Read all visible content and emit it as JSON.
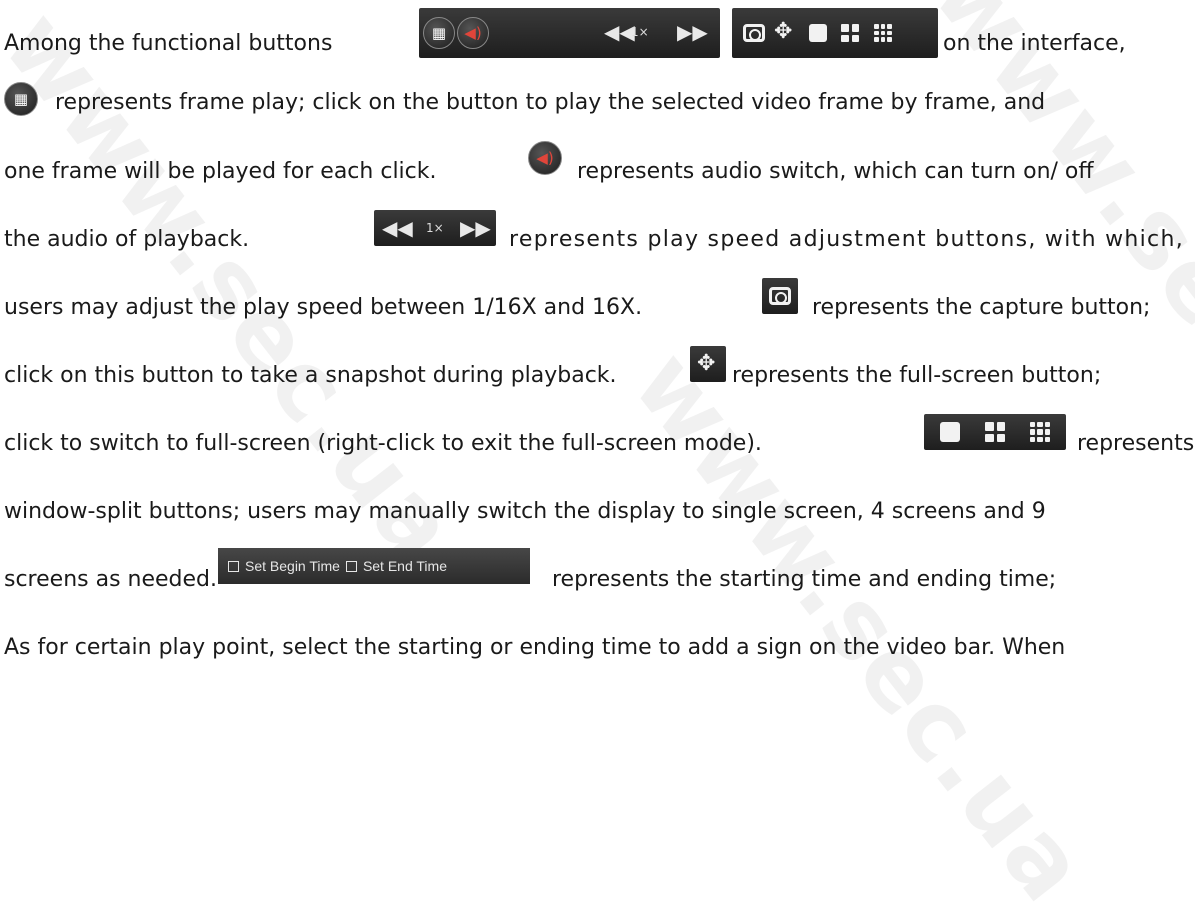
{
  "watermark": "www.sec.ua",
  "lines": [
    {
      "id": "l1",
      "segments": [
        "Among the functional buttons",
        "on the interface,"
      ]
    },
    {
      "id": "l2",
      "segments": [
        "represents frame play; click on the button to play the selected video frame by frame, and"
      ]
    },
    {
      "id": "l3",
      "segments": [
        "one frame will be played for each click.",
        "represents audio switch, which can turn on/ off"
      ]
    },
    {
      "id": "l4",
      "segments": [
        "the audio of playback.",
        "represents play speed adjustment buttons, with which,"
      ]
    },
    {
      "id": "l5",
      "segments": [
        "users may adjust the play speed between 1/16X and 16X.",
        "represents the capture button;"
      ]
    },
    {
      "id": "l6",
      "segments": [
        "click on this button to take a snapshot during playback.",
        "represents the full-screen button;"
      ]
    },
    {
      "id": "l7",
      "segments": [
        "click to switch to full-screen (right-click to exit the full-screen mode).",
        "represents"
      ]
    },
    {
      "id": "l8",
      "segments": [
        "window-split buttons; users may manually switch the display to single screen, 4 screens and 9"
      ]
    },
    {
      "id": "l9",
      "segments": [
        "screens as needed.",
        "represents the starting time and ending time;"
      ]
    },
    {
      "id": "l10",
      "segments": [
        "As for certain play point, select the starting or ending time to add a sign on the video bar. When"
      ]
    }
  ],
  "toolbar": {
    "speed_label": "1×",
    "set_begin_label": "Set Begin Time",
    "set_end_label": "Set End Time"
  },
  "icons": {
    "frame_play": "film-icon",
    "audio": "speaker-icon",
    "rewind": "rewind-icon",
    "forward": "fast-forward-icon",
    "capture": "camera-icon",
    "fullscreen": "move-arrows-icon",
    "split_1": "single-screen-icon",
    "split_4": "four-screen-icon",
    "split_9": "nine-screen-icon"
  },
  "colors": {
    "toolbar_bg": "#2b2b2b",
    "speaker_accent": "#e0453a",
    "text": "#1a1a1a"
  }
}
